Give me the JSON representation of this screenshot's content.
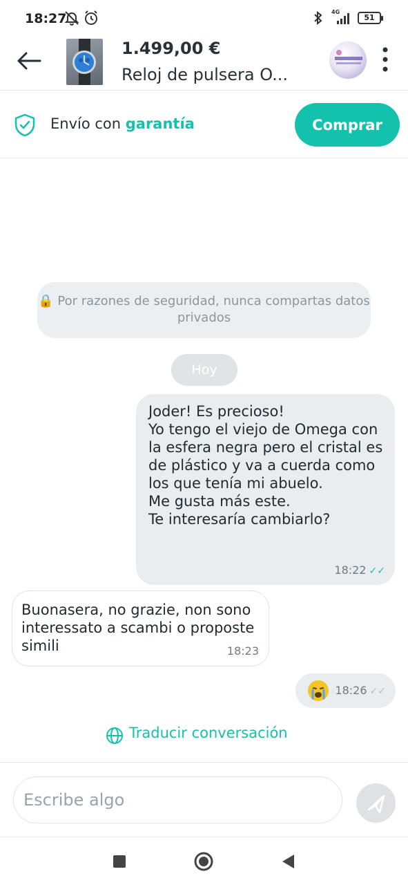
{
  "status_bar": {
    "time": "18:27",
    "network": "4G",
    "battery": "51"
  },
  "header": {
    "price": "1.499,00 €",
    "title": "Reloj de pulsera O..."
  },
  "guarantee": {
    "prefix": "Envío con ",
    "highlight": "garantía",
    "buy_label": "Comprar"
  },
  "chat": {
    "security_notice": "Por razones de seguridad, nunca compartas datos privados",
    "day_label": "Hoy",
    "messages": [
      {
        "direction": "outgoing",
        "text": "Joder! Es precioso!\nYo tengo el viejo de Omega con la esfera negra pero el cristal es de plástico y va a cuerda como los que tenía mi abuelo.\nMe gusta más este.\nTe interesaría cambiarlo?",
        "time": "18:22"
      },
      {
        "direction": "incoming",
        "text": "Buonasera, no grazie, non sono interessato a scambi o proposte simili",
        "time": "18:23"
      },
      {
        "direction": "outgoing",
        "emoji": "crying-face",
        "time": "18:26"
      }
    ],
    "translate_label": "Traducir conversación"
  },
  "composer": {
    "placeholder": "Escribe algo"
  },
  "colors": {
    "accent": "#13c1ac",
    "bubble_out": "#e9edf0",
    "text": "#263238"
  }
}
